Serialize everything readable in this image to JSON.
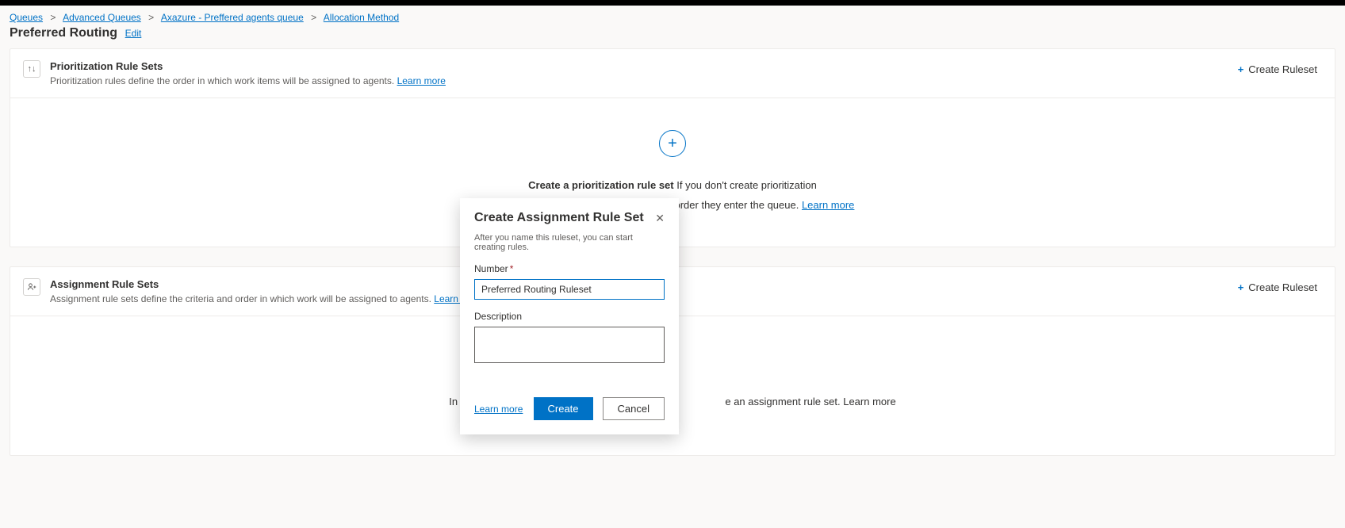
{
  "breadcrumb": {
    "items": [
      "Queues",
      "Advanced Queues",
      "Axazure - Preffered agents queue",
      "Allocation Method"
    ]
  },
  "page": {
    "title": "Preferred Routing",
    "edit": "Edit"
  },
  "prioritization": {
    "title": "Prioritization Rule Sets",
    "subtitle": "Prioritization rules define the order in which work items will be assigned to agents.",
    "learn_more": "Learn more",
    "create_ruleset": "Create Ruleset",
    "body_bold": "Create a prioritization rule set",
    "body_text1": " If you don't create prioritization",
    "body_text2": "rules, work items will be assigned in the order they enter the queue.  ",
    "body_learn": "Learn more"
  },
  "assignment": {
    "title": "Assignment Rule Sets",
    "subtitle": "Assignment rule sets define the criteria and order in which work will be assigned to agents.",
    "learn_more": "Learn more",
    "create_ruleset": "Create Ruleset",
    "body_left": "In order for t",
    "body_right": "e an assignment rule set.  ",
    "body_learn": "Learn more"
  },
  "modal": {
    "title": "Create Assignment Rule Set",
    "subtitle": "After you name this ruleset, you can start creating rules.",
    "number_label": "Number",
    "number_value": "Preferred Routing Ruleset",
    "description_label": "Description",
    "learn_more": "Learn more",
    "create": "Create",
    "cancel": "Cancel"
  }
}
